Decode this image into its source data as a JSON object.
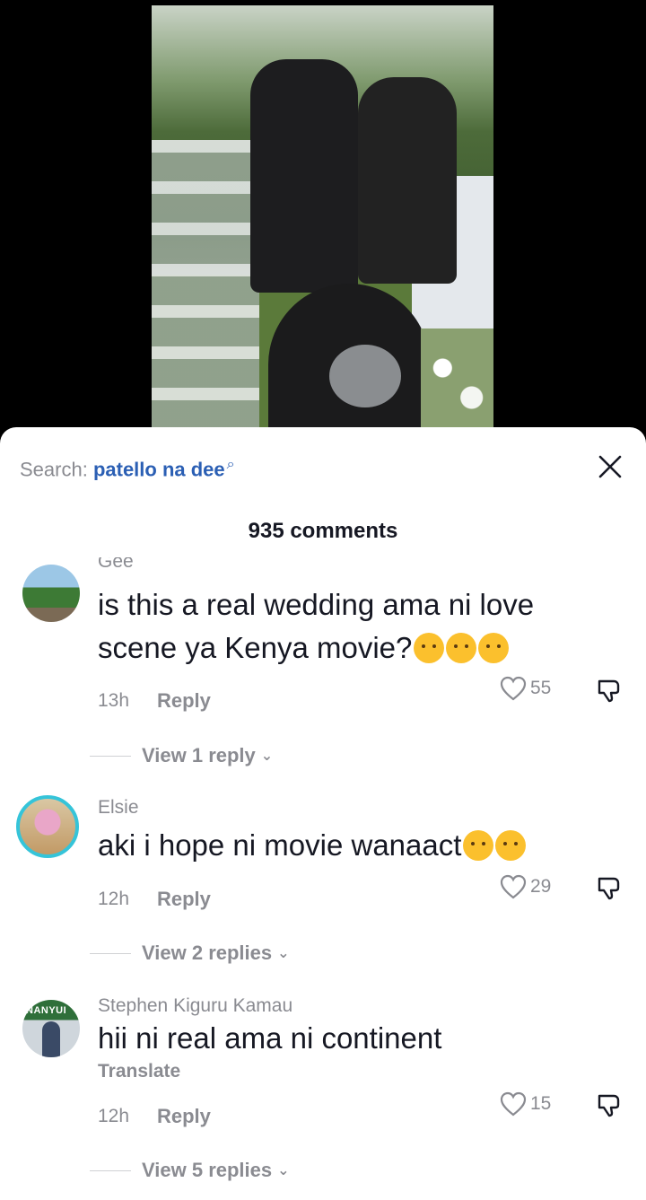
{
  "search": {
    "prefix": "Search: ",
    "query": "patello na dee"
  },
  "header": {
    "comment_count": "935 comments"
  },
  "comments": [
    {
      "username": "Gee",
      "text": "is this a real wedding ama ni love scene ya Kenya movie?",
      "emojis": [
        "thinking-face",
        "pleading-face",
        "rolling-on-floor-laughing"
      ],
      "time": "13h",
      "reply_label": "Reply",
      "likes": "55",
      "view_replies": "View 1 reply"
    },
    {
      "username": "Elsie",
      "text": "aki i hope ni movie wanaact",
      "emojis": [
        "loudly-crying-face",
        "face-with-tears-of-joy"
      ],
      "time": "12h",
      "reply_label": "Reply",
      "likes": "29",
      "view_replies": "View 2 replies"
    },
    {
      "username": "Stephen Kiguru Kamau",
      "text": "hii ni real ama ni continent",
      "translate": "Translate",
      "time": "12h",
      "reply_label": "Reply",
      "likes": "15",
      "view_replies": "View 5 replies",
      "avatar_text": "NANYUI"
    }
  ],
  "colors": {
    "accent": "#2b5fb4",
    "muted": "#8a8b91",
    "text": "#161823"
  }
}
